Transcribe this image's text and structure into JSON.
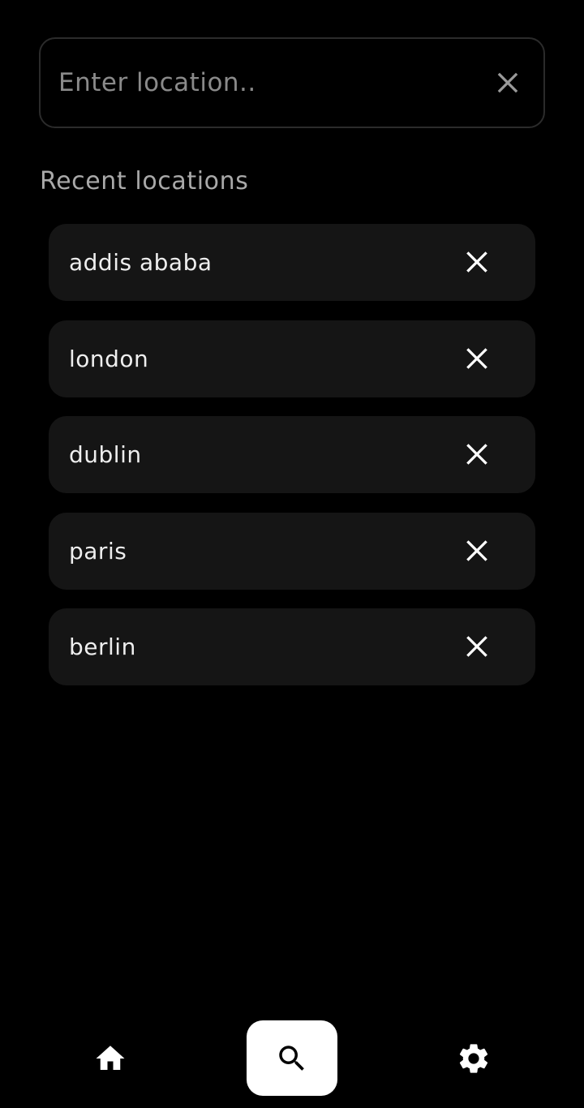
{
  "search": {
    "placeholder": "Enter location..",
    "value": "",
    "clear_icon": "close-icon"
  },
  "recent": {
    "title": "Recent locations",
    "items": [
      {
        "label": "addis ababa",
        "remove_icon": "close-icon"
      },
      {
        "label": "london",
        "remove_icon": "close-icon"
      },
      {
        "label": "dublin",
        "remove_icon": "close-icon"
      },
      {
        "label": "paris",
        "remove_icon": "close-icon"
      },
      {
        "label": "berlin",
        "remove_icon": "close-icon"
      }
    ]
  },
  "nav": {
    "items": [
      {
        "id": "home",
        "icon": "home-icon",
        "active": false
      },
      {
        "id": "search",
        "icon": "search-icon",
        "active": true
      },
      {
        "id": "settings",
        "icon": "gear-icon",
        "active": false
      }
    ]
  },
  "colors": {
    "background": "#000000",
    "card": "#151515",
    "border": "#2b2b2b",
    "text": "#eeeeee",
    "muted": "#a9a9a9",
    "active_nav_bg": "#ffffff"
  }
}
